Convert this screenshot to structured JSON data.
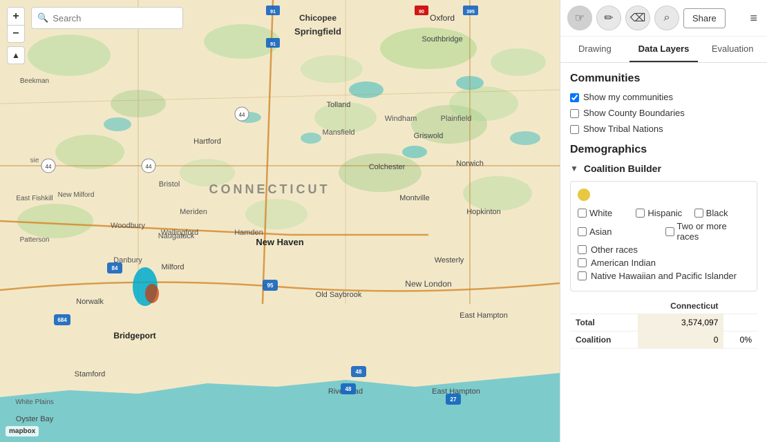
{
  "map": {
    "search_placeholder": "Search",
    "zoom_in_label": "+",
    "zoom_out_label": "−",
    "compass_label": "▲",
    "mapbox_label": "mapbox"
  },
  "toolbar": {
    "tools": [
      {
        "id": "hand",
        "icon": "☞",
        "label": "hand-tool",
        "active": true
      },
      {
        "id": "pencil",
        "icon": "✏",
        "label": "pencil-tool",
        "active": false
      },
      {
        "id": "eraser",
        "icon": "◈",
        "label": "eraser-tool",
        "active": false
      },
      {
        "id": "search",
        "icon": "🔍",
        "label": "search-tool",
        "active": false
      }
    ],
    "share_label": "Share",
    "menu_icon": "≡"
  },
  "tabs": [
    {
      "id": "drawing",
      "label": "Drawing"
    },
    {
      "id": "data-layers",
      "label": "Data Layers",
      "active": true
    },
    {
      "id": "evaluation",
      "label": "Evaluation"
    }
  ],
  "communities": {
    "header": "Communities",
    "show_my_communities": "Show my communities",
    "show_county_boundaries": "Show County Boundaries",
    "show_tribal_nations": "Show Tribal Nations",
    "my_communities_checked": true,
    "county_boundaries_checked": false,
    "tribal_nations_checked": false
  },
  "demographics": {
    "header": "Demographics",
    "coalition_builder": {
      "label": "Coalition Builder",
      "races": {
        "row1": [
          {
            "id": "white",
            "label": "White",
            "checked": false
          },
          {
            "id": "hispanic",
            "label": "Hispanic",
            "checked": false
          },
          {
            "id": "black",
            "label": "Black",
            "checked": false
          }
        ],
        "row2": [
          {
            "id": "asian",
            "label": "Asian",
            "checked": false
          },
          {
            "id": "two-or-more",
            "label": "Two or more races",
            "checked": false
          }
        ],
        "row3": [
          {
            "id": "other-races",
            "label": "Other races",
            "checked": false
          }
        ],
        "row4": [
          {
            "id": "american-indian",
            "label": "American Indian",
            "checked": false
          }
        ],
        "row5": [
          {
            "id": "native-hawaiian",
            "label": "Native Hawaiian and Pacific Islander",
            "checked": false
          }
        ]
      }
    }
  },
  "stats": {
    "column_header": "Connecticut",
    "rows": [
      {
        "label": "Total",
        "value": "3,574,097",
        "pct": ""
      },
      {
        "label": "Coalition",
        "value": "0",
        "pct": "0%"
      }
    ]
  }
}
